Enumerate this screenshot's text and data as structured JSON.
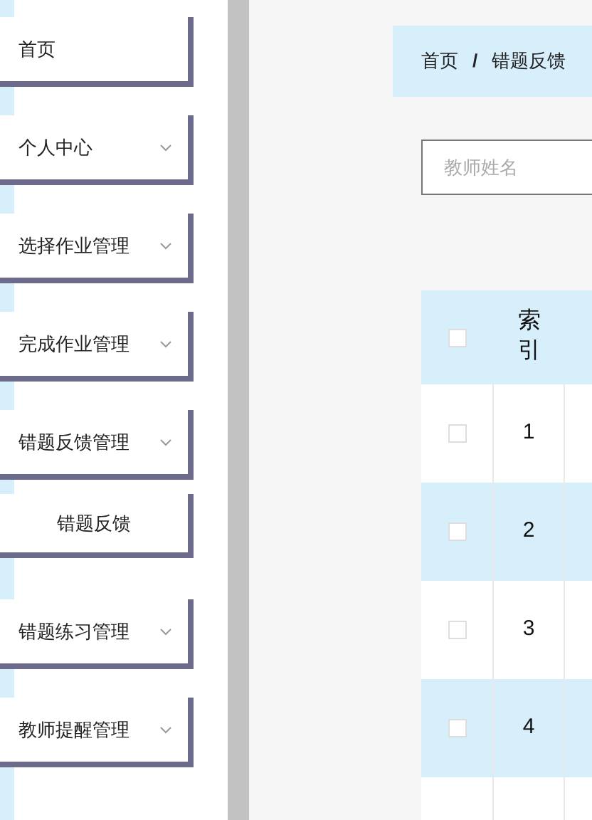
{
  "sidebar": {
    "items": [
      {
        "label": "首页",
        "kind": "link"
      },
      {
        "label": "个人中心",
        "kind": "submenu"
      },
      {
        "label": "选择作业管理",
        "kind": "submenu"
      },
      {
        "label": "完成作业管理",
        "kind": "submenu"
      },
      {
        "label": "错题反馈管理",
        "kind": "submenu",
        "children": [
          {
            "label": "错题反馈"
          }
        ]
      },
      {
        "label": "错题练习管理",
        "kind": "submenu"
      },
      {
        "label": "教师提醒管理",
        "kind": "submenu"
      }
    ]
  },
  "breadcrumb": [
    "首页",
    "错题反馈"
  ],
  "breadcrumb_separator": "/",
  "search": {
    "placeholder": "教师姓名"
  },
  "table": {
    "select_all_checked": false,
    "columns": [
      "索引"
    ],
    "rows": [
      {
        "index": "1",
        "checked": false
      },
      {
        "index": "2",
        "checked": false
      },
      {
        "index": "3",
        "checked": false
      },
      {
        "index": "4",
        "checked": false
      }
    ]
  }
}
